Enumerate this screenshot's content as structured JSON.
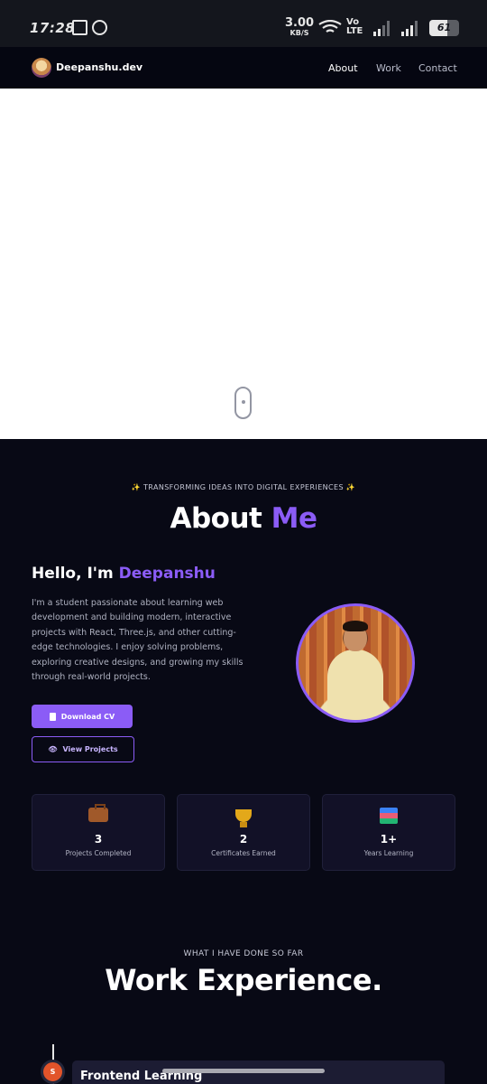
{
  "status_bar": {
    "time": "17:28",
    "speed_value": "3.00",
    "speed_unit": "KB/S",
    "network_line1": "Vo",
    "network_line2": "LTE",
    "battery": "61",
    "icons": [
      "notification-icon",
      "whatsapp-icon",
      "wifi-icon",
      "signal-icon",
      "battery-icon"
    ]
  },
  "nav": {
    "brand": "Deepanshu.dev",
    "links": [
      "About",
      "Work",
      "Contact"
    ],
    "active": "About"
  },
  "about": {
    "eyebrow": "✨ TRANSFORMING IDEAS INTO DIGITAL EXPERIENCES ✨",
    "title_part1": "About ",
    "title_part2": "Me",
    "greeting_part1": "Hello, I'm ",
    "greeting_name": "Deepanshu",
    "bio": "I'm a student passionate about learning web development and building modern, interactive projects with React, Three.js, and other cutting-edge technologies. I enjoy solving problems, exploring creative designs, and growing my skills through real-world projects.",
    "download_cv": "Download CV",
    "view_projects": "View Projects",
    "accent_color": "#8b5cf6"
  },
  "stats": [
    {
      "icon": "briefcase-icon",
      "value": "3",
      "label": "Projects Completed"
    },
    {
      "icon": "trophy-icon",
      "value": "2",
      "label": "Certificates Earned"
    },
    {
      "icon": "books-icon",
      "value": "1+",
      "label": "Years Learning"
    }
  ],
  "work": {
    "eyebrow": "WHAT I HAVE DONE SO FAR",
    "title": "Work Experience.",
    "timeline": [
      {
        "node_label": "S",
        "title": "Frontend Learning"
      }
    ]
  }
}
